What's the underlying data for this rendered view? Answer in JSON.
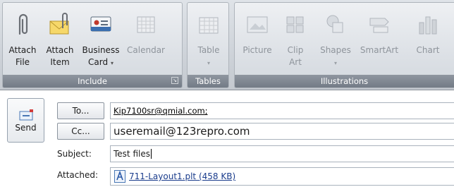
{
  "ribbon": {
    "groups": [
      {
        "name": "Include",
        "buttons": [
          {
            "label1": "Attach",
            "label2": "File",
            "icon": "paperclip-icon"
          },
          {
            "label1": "Attach",
            "label2": "Item",
            "icon": "envelope-paperclip-icon"
          },
          {
            "label1": "Business",
            "label2": "Card",
            "dropdown": "▾",
            "icon": "business-card-icon"
          },
          {
            "label1": "Calendar",
            "label2": "",
            "icon": "calendar-icon",
            "disabled": true
          }
        ]
      },
      {
        "name": "Tables",
        "buttons": [
          {
            "label1": "Table",
            "label2": "",
            "dropdown": "▾",
            "icon": "table-icon",
            "disabled": true
          }
        ]
      },
      {
        "name": "Illustrations",
        "buttons": [
          {
            "label1": "Picture",
            "label2": "",
            "icon": "picture-icon",
            "disabled": true
          },
          {
            "label1": "Clip",
            "label2": "Art",
            "icon": "clip-art-icon",
            "disabled": true
          },
          {
            "label1": "Shapes",
            "label2": "",
            "dropdown": "▾",
            "icon": "shapes-icon",
            "disabled": true
          },
          {
            "label1": "SmartArt",
            "label2": "",
            "icon": "smartart-icon",
            "disabled": true
          },
          {
            "label1": "Chart",
            "label2": "",
            "icon": "chart-icon",
            "disabled": true
          }
        ]
      }
    ]
  },
  "message": {
    "send_label": "Send",
    "to_button": "To...",
    "cc_button": "Cc...",
    "to_value": "Kip7100sr@qmial.com;",
    "cc_value": "useremail@123repro.com",
    "subject_label": "Subject:",
    "subject_value": "Test files",
    "attached_label": "Attached:",
    "attachment": "711-Layout1.plt (458 KB)"
  },
  "colors": {
    "ribbon_footer": "#7f8791",
    "link": "#1a3c8c"
  }
}
